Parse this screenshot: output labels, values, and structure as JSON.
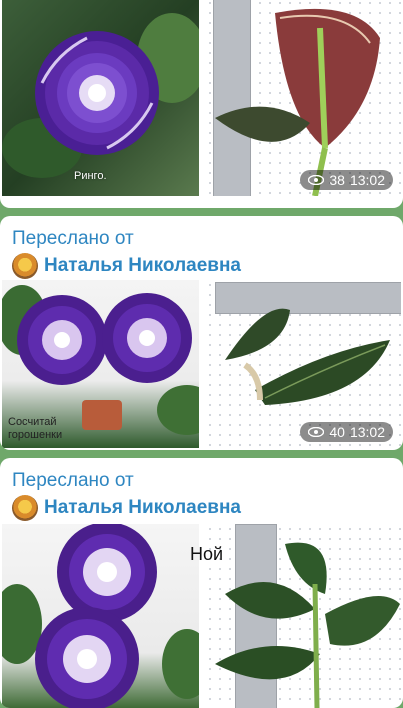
{
  "messages": [
    {
      "left_caption": "Ринго.",
      "views": "38",
      "time": "13:02"
    },
    {
      "forwarded_label": "Переслано от",
      "forwarded_name": "Наталья Николаевна",
      "left_caption": "Сосчитай горошенки",
      "views": "40",
      "time": "13:02"
    },
    {
      "forwarded_label": "Переслано от",
      "forwarded_name": "Наталья Николаевна",
      "right_label": "Ной"
    }
  ],
  "colors": {
    "chat_bg": "#6fa86a",
    "forward_blue": "#2e86c1",
    "petal_purple": "#5b2aa8"
  }
}
